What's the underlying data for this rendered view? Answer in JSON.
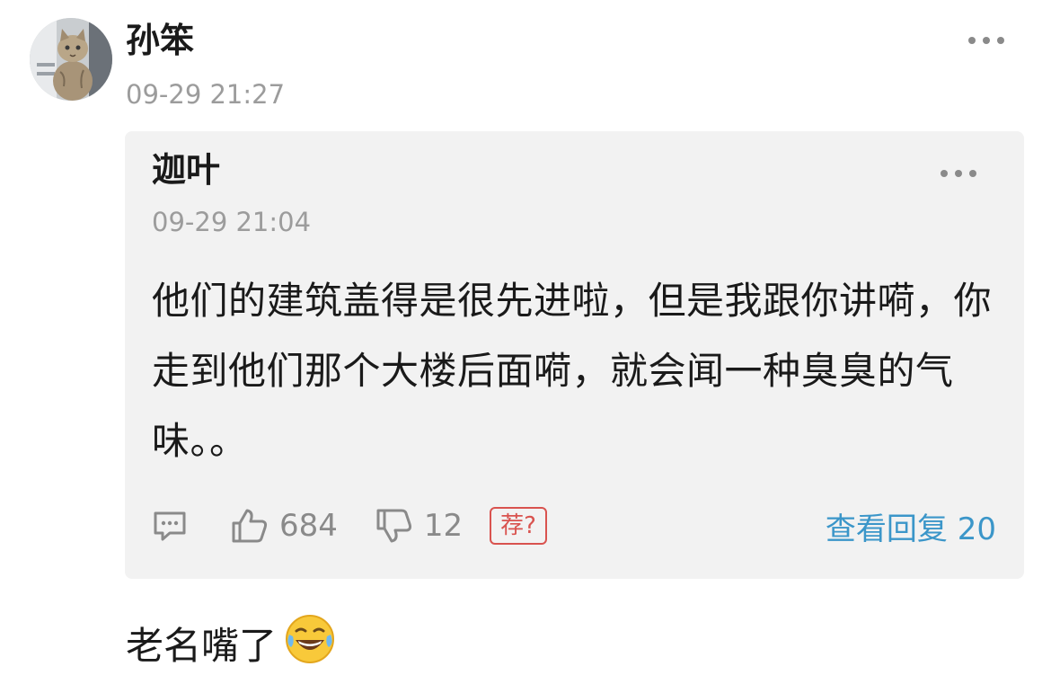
{
  "post": {
    "author": "孙笨",
    "timestamp": "09-29 21:27",
    "more_icon": "more-dots-icon",
    "avatar_icon": "cat-avatar"
  },
  "quote": {
    "author": "迦叶",
    "timestamp": "09-29 21:04",
    "text": "他们的建筑盖得是很先进啦，但是我跟你讲嗬，你走到他们那个大楼后面嗬，就会闻一种臭臭的气味。。",
    "comment_icon": "comment-icon",
    "like_icon": "thumb-up-icon",
    "like_count": "684",
    "dislike_icon": "thumb-down-icon",
    "dislike_count": "12",
    "recommend_label": "荐?",
    "view_replies": "查看回复 20"
  },
  "reply": {
    "text": "老名嘴了",
    "emoji_icon": "laughing-tears-emoji"
  },
  "colors": {
    "link": "#3b96c9",
    "badge": "#d9534f",
    "muted": "#9c9c9c",
    "quote_bg": "#f2f2f2"
  }
}
